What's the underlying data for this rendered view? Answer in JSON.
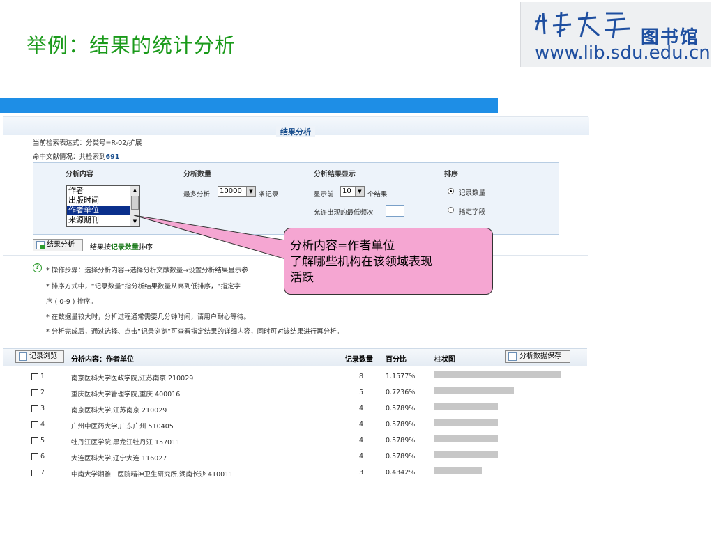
{
  "slide": {
    "title": "举例：结果的统计分析"
  },
  "logo": {
    "calligraphy": "山东大学",
    "library_name": "图书馆",
    "url": "www.lib.sdu.edu.cn"
  },
  "panel": {
    "title": "结果分析",
    "query_label": "当前检索表达式：",
    "query_value": "分类号=R-02/扩展",
    "hits_label": "命中文献情况：",
    "hits_text": "共检索到",
    "hits_count": "691",
    "columns": {
      "content": "分析内容",
      "count": "分析数量",
      "display": "分析结果显示",
      "sort": "排序"
    },
    "content_options": [
      "作者",
      "出版时间",
      "作者单位",
      "来源期刊"
    ],
    "content_selected": "作者单位",
    "count_prefix": "最多分析",
    "count_value": "10000",
    "count_suffix": "条记录",
    "display_prefix": "显示前",
    "display_value": "10",
    "display_suffix": "个结果",
    "min_freq_label": "允许出现的最低频次",
    "min_freq_value": "",
    "sort_options": [
      "记录数量",
      "指定字段"
    ],
    "analyze_button": "结果分析",
    "sort_note_prefix": "结果按",
    "sort_note_key": "记录数量",
    "sort_note_suffix": "排序"
  },
  "help_lines": [
    "* 操作步骤：选择分析内容→选择分析文献数量→设置分析结果显示参",
    "* 排序方式中，“记录数量”指分析结果数量从高到低排序，“指定字",
    "序 ( 0-9 ) 排序。",
    "* 在数据量较大时，分析过程通常需要几分钟时间，请用户耐心等待。",
    "* 分析完成后，通过选择、点击“记录浏览”可查看指定结果的详细内容，同时可对该结果进行再分析。"
  ],
  "callout": {
    "line1": "分析内容=作者单位",
    "line2": "了解哪些机构在该领域表现",
    "line3": "活跃"
  },
  "results": {
    "browse_button": "记录浏览",
    "content_header": "分析内容：作者单位",
    "count_header": "记录数量",
    "pct_header": "百分比",
    "bar_header": "柱状图",
    "save_button": "分析数据保存",
    "rows": [
      {
        "no": "1",
        "inst": "南京医科大学医政学院,江苏南京  210029",
        "count": "8",
        "pct": "1.1577%",
        "value": 8
      },
      {
        "no": "2",
        "inst": "重庆医科大学管理学院,重庆  400016",
        "count": "5",
        "pct": "0.7236%",
        "value": 5
      },
      {
        "no": "3",
        "inst": "南京医科大学,江苏南京  210029",
        "count": "4",
        "pct": "0.5789%",
        "value": 4
      },
      {
        "no": "4",
        "inst": "广州中医药大学,广东广州  510405",
        "count": "4",
        "pct": "0.5789%",
        "value": 4
      },
      {
        "no": "5",
        "inst": "牡丹江医学院,黑龙江牡丹江  157011",
        "count": "4",
        "pct": "0.5789%",
        "value": 4
      },
      {
        "no": "6",
        "inst": "大连医科大学,辽宁大连  116027",
        "count": "4",
        "pct": "0.5789%",
        "value": 4
      },
      {
        "no": "7",
        "inst": "中南大学湘雅二医院精神卫生研究所,湖南长沙  410011",
        "count": "3",
        "pct": "0.4342%",
        "value": 3
      }
    ]
  }
}
